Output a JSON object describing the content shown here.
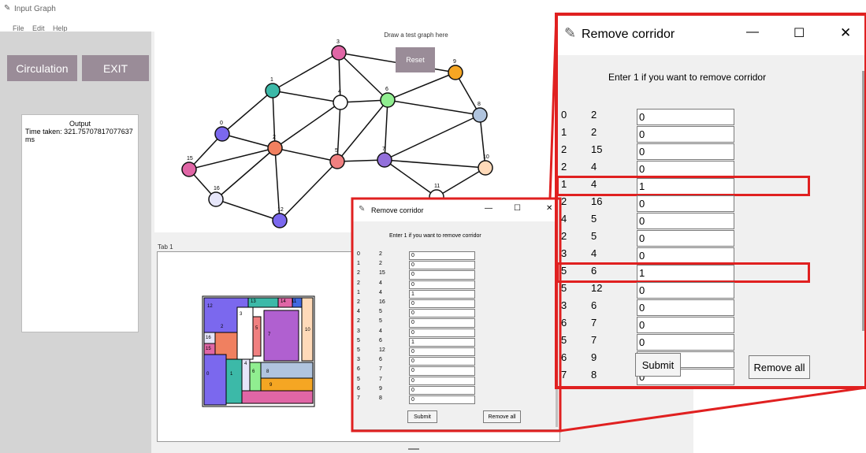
{
  "main_window": {
    "title": "Input Graph",
    "menu": [
      "File",
      "Edit",
      "Help"
    ],
    "buttons": {
      "circulation": "Circulation",
      "exit": "EXIT"
    },
    "output": {
      "heading": "Output",
      "text": "Time taken: 321.75707817077637 ms"
    },
    "graph": {
      "instruction": "Draw a test graph here",
      "reset": "Reset"
    },
    "tab_label": "Tab 1"
  },
  "graph_nodes": [
    {
      "label": "0",
      "color": "#7b68ee"
    },
    {
      "label": "1",
      "color": "#3cb9a8"
    },
    {
      "label": "2",
      "color": "#f08060"
    },
    {
      "label": "3",
      "color": "#e066a6"
    },
    {
      "label": "4",
      "color": "#ffffff"
    },
    {
      "label": "5",
      "color": "#f08080"
    },
    {
      "label": "6",
      "color": "#90ee90"
    },
    {
      "label": "7",
      "color": "#9370db"
    },
    {
      "label": "8",
      "color": "#b0c4de"
    },
    {
      "label": "9",
      "color": "#f5a623"
    },
    {
      "label": "10",
      "color": "#ffdab9"
    },
    {
      "label": "11",
      "color": "#ffffff"
    },
    {
      "label": "12",
      "color": "#7b68ee"
    },
    {
      "label": "15",
      "color": "#e066a6"
    },
    {
      "label": "16",
      "color": "#e6e6fa"
    }
  ],
  "floorplan_labels": [
    "12",
    "13",
    "14",
    "11",
    "10",
    "2",
    "3",
    "5",
    "7",
    "4",
    "6",
    "8",
    "9",
    "1",
    "0",
    "16",
    "15"
  ],
  "remove_dialog": {
    "title": "Remove corridor",
    "instruction": "Enter 1 if you want to remove corridor",
    "rows": [
      {
        "a": "0",
        "b": "2",
        "value": "0"
      },
      {
        "a": "1",
        "b": "2",
        "value": "0"
      },
      {
        "a": "2",
        "b": "15",
        "value": "0"
      },
      {
        "a": "2",
        "b": "4",
        "value": "0"
      },
      {
        "a": "1",
        "b": "4",
        "value": "1"
      },
      {
        "a": "2",
        "b": "16",
        "value": "0"
      },
      {
        "a": "4",
        "b": "5",
        "value": "0"
      },
      {
        "a": "2",
        "b": "5",
        "value": "0"
      },
      {
        "a": "3",
        "b": "4",
        "value": "0"
      },
      {
        "a": "5",
        "b": "6",
        "value": "1"
      },
      {
        "a": "5",
        "b": "12",
        "value": "0"
      },
      {
        "a": "3",
        "b": "6",
        "value": "0"
      },
      {
        "a": "6",
        "b": "7",
        "value": "0"
      },
      {
        "a": "5",
        "b": "7",
        "value": "0"
      },
      {
        "a": "6",
        "b": "9",
        "value": "0"
      },
      {
        "a": "7",
        "b": "8",
        "value": "0"
      }
    ],
    "submit": "Submit",
    "remove_all": "Remove all",
    "controls": {
      "minimize": "—",
      "maximize": "☐",
      "close": "✕"
    }
  },
  "colors": {
    "highlight": "#e02020",
    "button": "#9a8c98",
    "panel": "#d4d4d4"
  }
}
